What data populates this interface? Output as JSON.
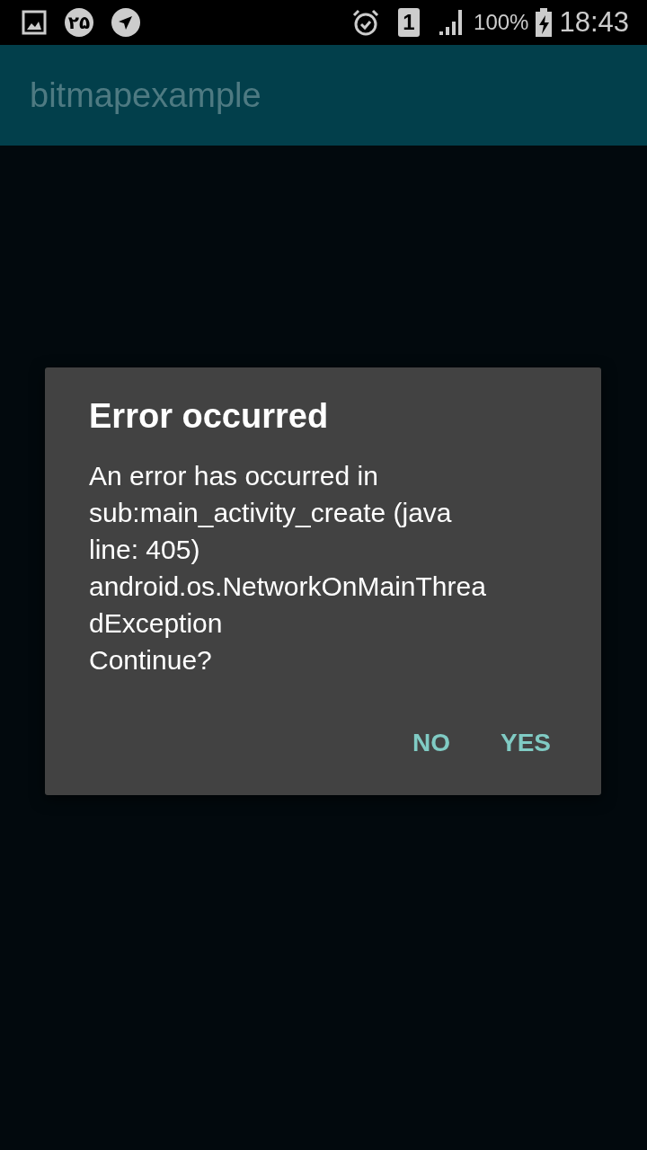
{
  "status_bar": {
    "notification_badge": "۲۵",
    "sim_number": "1",
    "battery": "100%",
    "time": "18:43"
  },
  "app_bar": {
    "title": "bitmapexample"
  },
  "dialog": {
    "title": "Error occurred",
    "message": "An error has occurred in\nsub:main_activity_create (java\nline: 405)\nandroid.os.NetworkOnMainThrea\ndException\nContinue?",
    "buttons": [
      {
        "label": "NO"
      },
      {
        "label": "YES"
      }
    ]
  }
}
